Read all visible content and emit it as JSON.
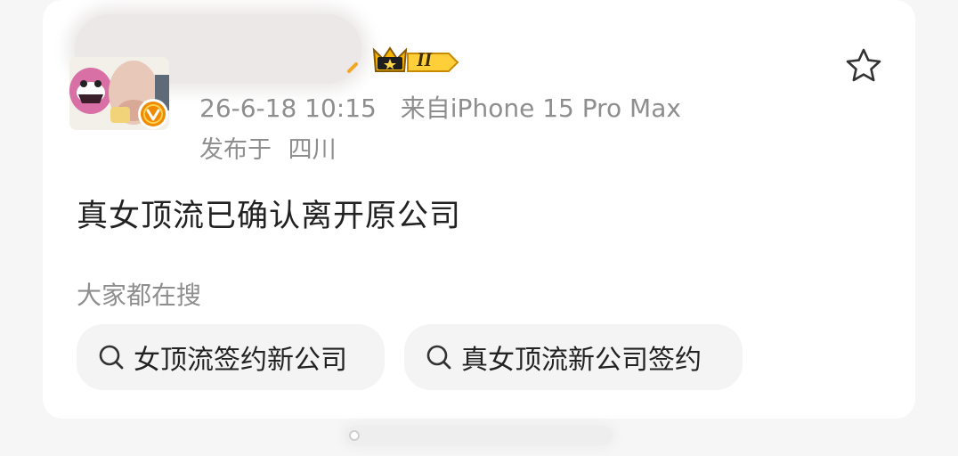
{
  "post": {
    "timestamp": "26-6-18 10:15",
    "source": "来自iPhone 15 Pro Max",
    "location_prefix": "发布于",
    "location": "四川",
    "text": "真女顶流已确认离开原公司",
    "level_badge": "II"
  },
  "search": {
    "section_title": "大家都在搜",
    "suggestions": [
      {
        "label": "女顶流签约新公司"
      },
      {
        "label": "真女顶流新公司签约"
      }
    ]
  },
  "icons": {
    "star": "star-icon",
    "search": "search-icon",
    "verified": "verified-badge-icon",
    "crown": "crown-icon"
  },
  "colors": {
    "text_primary": "#222222",
    "text_secondary": "#8e8e8e",
    "chip_background": "#f4f4f4",
    "badge_gold": "#f5b400",
    "verified_orange": "#f08a00"
  }
}
